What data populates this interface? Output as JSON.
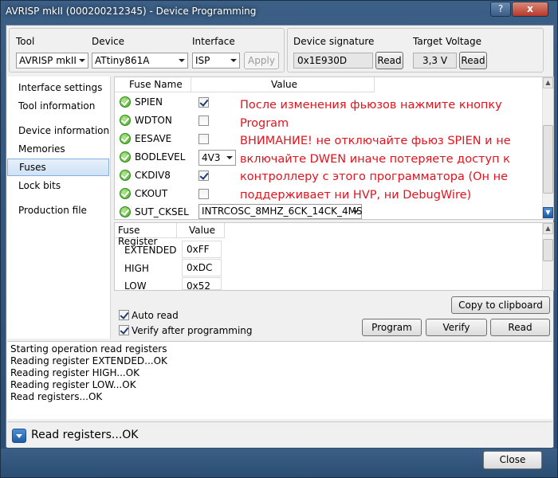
{
  "window": {
    "title": "AVRISP mkII (000200212345) - Device Programming",
    "help_label": "?",
    "close_label": "x"
  },
  "toolbar": {
    "tool_label": "Tool",
    "tool_value": "AVRISP mkII",
    "device_label": "Device",
    "device_value": "ATtiny861A",
    "interface_label": "Interface",
    "interface_value": "ISP",
    "apply_label": "Apply",
    "signature_label": "Device signature",
    "signature_value": "0x1E930D",
    "signature_read_label": "Read",
    "voltage_label": "Target Voltage",
    "voltage_value": "3,3 V",
    "voltage_read_label": "Read"
  },
  "nav": {
    "items": [
      {
        "label": "Interface settings",
        "selected": false
      },
      {
        "label": "Tool information",
        "selected": false
      },
      {
        "label": "Device information",
        "selected": false
      },
      {
        "label": "Memories",
        "selected": false
      },
      {
        "label": "Fuses",
        "selected": true
      },
      {
        "label": "Lock bits",
        "selected": false
      },
      {
        "label": "Production file",
        "selected": false
      }
    ]
  },
  "fuses": {
    "col_name": "Fuse Name",
    "col_value": "Value",
    "rows": [
      {
        "name": "SPIEN",
        "kind": "checkbox",
        "checked": true
      },
      {
        "name": "WDTON",
        "kind": "checkbox",
        "checked": false
      },
      {
        "name": "EESAVE",
        "kind": "checkbox",
        "checked": false
      },
      {
        "name": "BODLEVEL",
        "kind": "select",
        "value": "4V3"
      },
      {
        "name": "CKDIV8",
        "kind": "checkbox",
        "checked": true
      },
      {
        "name": "CKOUT",
        "kind": "checkbox",
        "checked": false
      },
      {
        "name": "SUT_CKSEL",
        "kind": "select",
        "value": "INTRCOSC_8MHZ_6CK_14CK_4MS"
      }
    ],
    "note": "После изменения фьюзов нажмите кнопку Program\nВНИМАНИЕ! не отключайте фьюз SPIEN и не включайте DWEN иначе потеряете доступ к контроллеру с этого программатора (Он не поддерживает ни HVP, ни DebugWire)"
  },
  "registers": {
    "col_name": "Fuse Register",
    "col_value": "Value",
    "rows": [
      {
        "name": "EXTENDED",
        "value": "0xFF"
      },
      {
        "name": "HIGH",
        "value": "0xDC"
      },
      {
        "name": "LOW",
        "value": "0x52"
      }
    ]
  },
  "options": {
    "auto_read_label": "Auto read",
    "auto_read_checked": true,
    "verify_label": "Verify after programming",
    "verify_checked": true
  },
  "actions": {
    "copy_label": "Copy to clipboard",
    "program_label": "Program",
    "verify_label": "Verify",
    "read_label": "Read"
  },
  "log": {
    "lines": [
      "Starting operation read registers",
      "Reading register EXTENDED...OK",
      "Reading register HIGH...OK",
      "Reading register LOW...OK",
      "Read registers...OK"
    ]
  },
  "status": {
    "text": "Read registers...OK"
  },
  "footer": {
    "close_label": "Close"
  }
}
